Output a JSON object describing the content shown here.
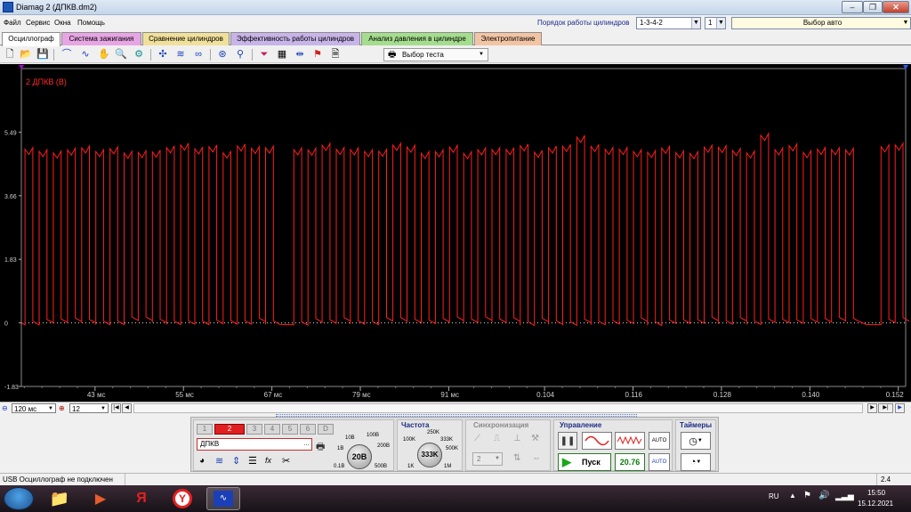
{
  "window": {
    "title": "Diamag 2 (ДПКВ.dm2)",
    "controls": [
      "–",
      "❐",
      "✕"
    ]
  },
  "menu": [
    "Файл",
    "Сервис",
    "Окна",
    "Помощь"
  ],
  "cylinders": {
    "label": "Порядок работы цилиндров",
    "order_value": "1-3-4-2",
    "number_value": "1",
    "car_select": "Выбор авто"
  },
  "tabs": [
    {
      "label": "Осциллограф",
      "color": "#ffffff",
      "active": true
    },
    {
      "label": "Система зажигания",
      "color": "#e7a5e4"
    },
    {
      "label": "Сравнение цилиндров",
      "color": "#f0e09a"
    },
    {
      "label": "Эффективность работы цилиндров",
      "color": "#c7b4e8"
    },
    {
      "label": "Анализ давления в цилиндре",
      "color": "#a5dd8e"
    },
    {
      "label": "Электропитание",
      "color": "#f3c4a4"
    }
  ],
  "toolbar": {
    "icons": [
      "new-file-icon",
      "open-folder-icon",
      "save-icon",
      "cursor-a-icon",
      "cursor-b-icon",
      "hand-icon",
      "zoom-icon",
      "marker-icon",
      "autoscale-icon",
      "wave-icon",
      "filter-icon",
      "measure-icon",
      "channel-icon",
      "filter2-icon",
      "table-icon",
      "split-icon",
      "flag-icon",
      "document-icon"
    ],
    "test_select": "Выбор теста"
  },
  "scope": {
    "channel_label": "2 ДПКВ (В)",
    "trace_color": "#ff1e1e",
    "y_ticks": [
      "5.49",
      "3.66",
      "1.83",
      "0",
      "-1.83"
    ],
    "x_ticks": [
      "43 мс",
      "55 мс",
      "67 мс",
      "79 мс",
      "91 мс",
      "0.104",
      "0.116",
      "0.128",
      "0.140",
      "0.152"
    ],
    "signal": {
      "high_v": 5.0,
      "low_v": 0.0,
      "period_ms": 1.92,
      "gap_starts_ms": [
        66.8,
        146.6
      ],
      "gap_length_ms": 2.6,
      "x_range_ms": [
        33.0,
        153.0
      ],
      "y_range_v": [
        -1.83,
        7.32
      ]
    }
  },
  "timebase": {
    "value": "120 мс",
    "samples": "12"
  },
  "panel": {
    "channels": [
      "1",
      "2",
      "3",
      "4",
      "5",
      "6",
      "D"
    ],
    "active_channel": "2",
    "channel_name": "ДПКВ",
    "volts_group": {
      "knob_value": "20В",
      "scale": [
        "10В",
        "100В",
        "1В",
        "200В",
        "0.1В",
        "500В"
      ]
    },
    "freq_group": {
      "title": "Частота",
      "knob_value": "333K",
      "scale": [
        "250K",
        "100K",
        "333K",
        "500K",
        "1K",
        "1M"
      ]
    },
    "sync_group": {
      "title": "Синхронизация",
      "value": "2"
    },
    "control_group": {
      "title": "Управление",
      "start_label": "Пуск",
      "voltage_readout": "20.76"
    },
    "timers_group": {
      "title": "Таймеры"
    }
  },
  "status": {
    "text": "USB Осциллограф не подключен",
    "right_value": "2.4"
  },
  "taskbar": {
    "lang": "RU",
    "time": "15:50",
    "date": "15.12.2021"
  }
}
